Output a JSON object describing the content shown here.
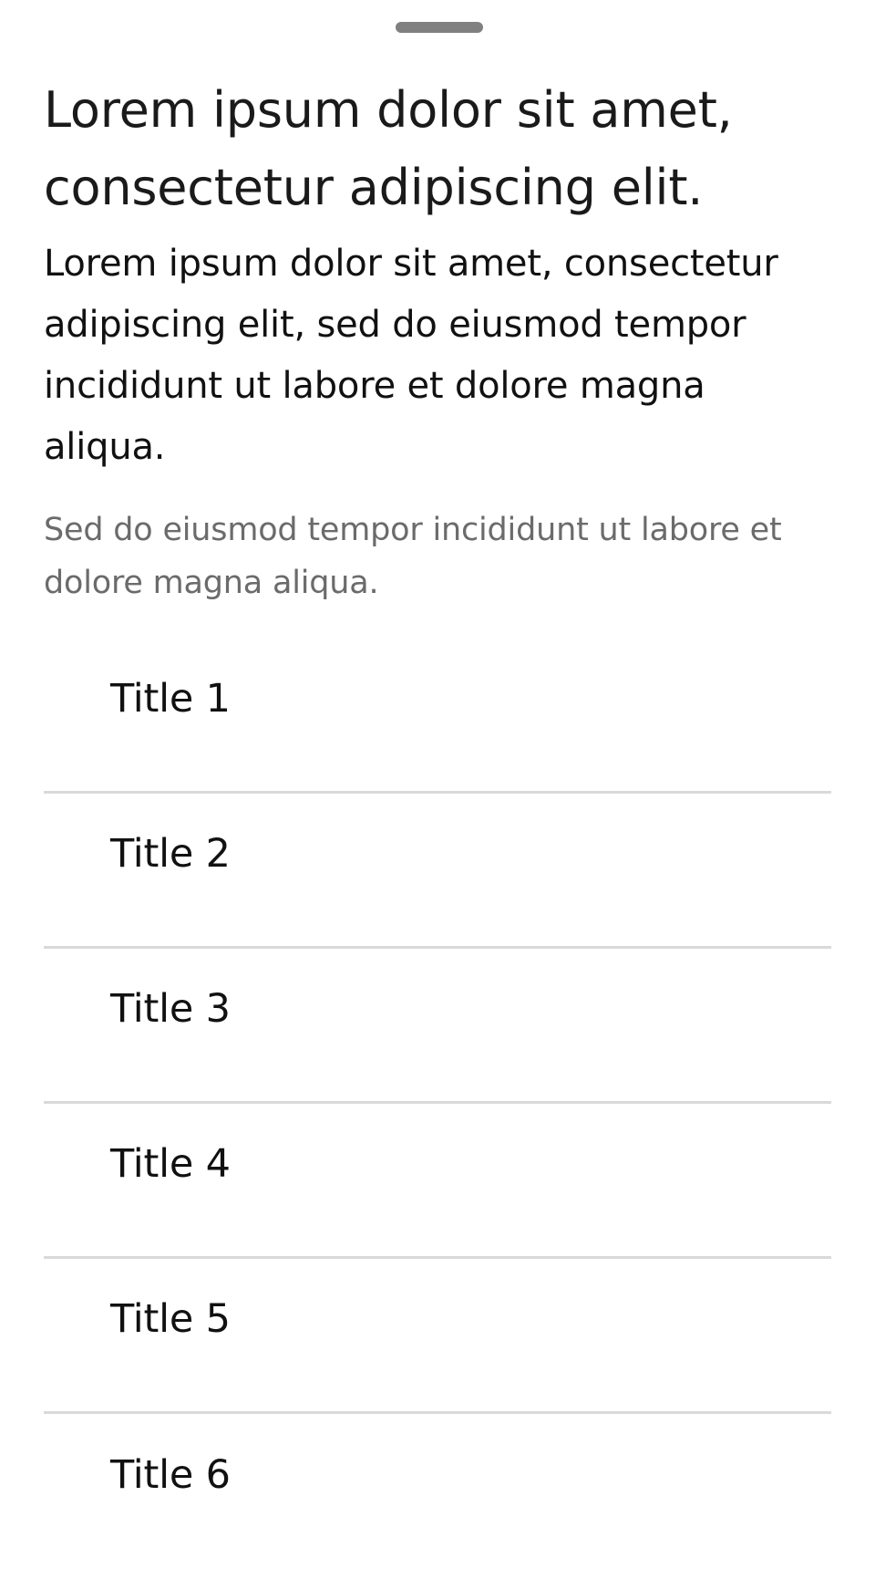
{
  "sheet": {
    "title": "Lorem ipsum dolor sit amet, consectetur adipiscing elit.",
    "body": "Lorem ipsum dolor sit amet, consectetur adipiscing elit, sed do eiusmod tempor incididunt ut labore et dolore magna aliqua.",
    "secondary": "Sed do eiusmod tempor incididunt ut labore et dolore magna aliqua."
  },
  "list": {
    "items": [
      {
        "title": "Title 1"
      },
      {
        "title": "Title 2"
      },
      {
        "title": "Title 3"
      },
      {
        "title": "Title 4"
      },
      {
        "title": "Title 5"
      },
      {
        "title": "Title 6"
      }
    ]
  },
  "colors": {
    "handle": "#808080",
    "divider": "#d9d9d9",
    "secondary_text": "#6b6b6b",
    "background": "#ffffff"
  }
}
